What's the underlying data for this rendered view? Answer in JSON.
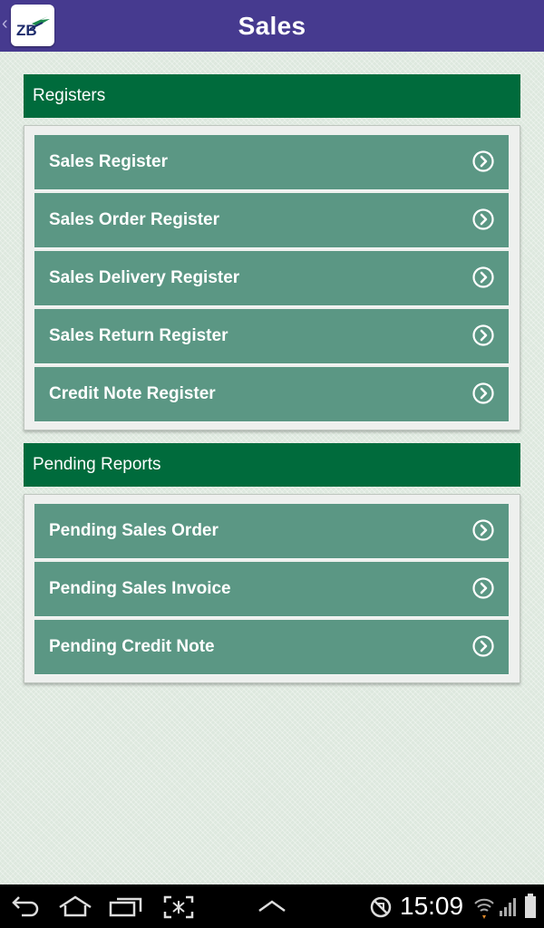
{
  "header": {
    "title": "Sales",
    "logo_text": "ZB",
    "back_glyph": "‹",
    "background": "#463a8f"
  },
  "sections": [
    {
      "title": "Registers",
      "items": [
        {
          "label": "Sales Register",
          "icon": "chevron-right-circle-icon"
        },
        {
          "label": "Sales Order Register",
          "icon": "chevron-right-circle-icon"
        },
        {
          "label": "Sales Delivery Register",
          "icon": "chevron-right-circle-icon"
        },
        {
          "label": "Sales Return Register",
          "icon": "chevron-right-circle-icon"
        },
        {
          "label": "Credit Note Register",
          "icon": "chevron-right-circle-icon"
        }
      ]
    },
    {
      "title": "Pending Reports",
      "items": [
        {
          "label": "Pending Sales Order",
          "icon": "chevron-right-circle-icon"
        },
        {
          "label": "Pending Sales Invoice",
          "icon": "chevron-right-circle-icon"
        },
        {
          "label": "Pending Credit Note",
          "icon": "chevron-right-circle-icon"
        }
      ]
    }
  ],
  "colors": {
    "section_header": "#006b3c",
    "menu_item": "#5b9784",
    "background": "#dde8de"
  },
  "system_bar": {
    "time": "15:09",
    "buttons": [
      "back-icon",
      "home-icon",
      "recent-apps-icon",
      "screenshot-icon",
      "up-chevron-icon"
    ],
    "status_icons": [
      "sync-blocked-icon",
      "wifi-icon",
      "signal-icon",
      "battery-icon"
    ]
  }
}
